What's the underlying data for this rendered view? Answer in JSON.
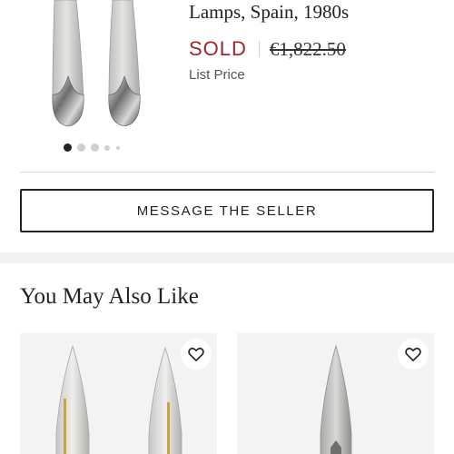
{
  "product": {
    "title": "Lamps, Spain, 1980s",
    "status": "SOLD",
    "old_price": "€1,822.50",
    "price_label": "List Price",
    "image_icon": "wall-sconce-pair",
    "carousel": {
      "slide_count": 5,
      "active_index": 0
    }
  },
  "actions": {
    "message_seller": "MESSAGE THE SELLER"
  },
  "recommendations": {
    "title": "You May Also Like",
    "items": [
      {
        "image_icon": "brass-sconce-pair",
        "favorite_icon": "heart-outline-icon"
      },
      {
        "image_icon": "single-sconce",
        "favorite_icon": "heart-outline-icon"
      }
    ]
  },
  "colors": {
    "sold": "#a1242c",
    "text": "#222222",
    "divider": "#d9d9d9",
    "card_background": "#f3f3f3"
  }
}
